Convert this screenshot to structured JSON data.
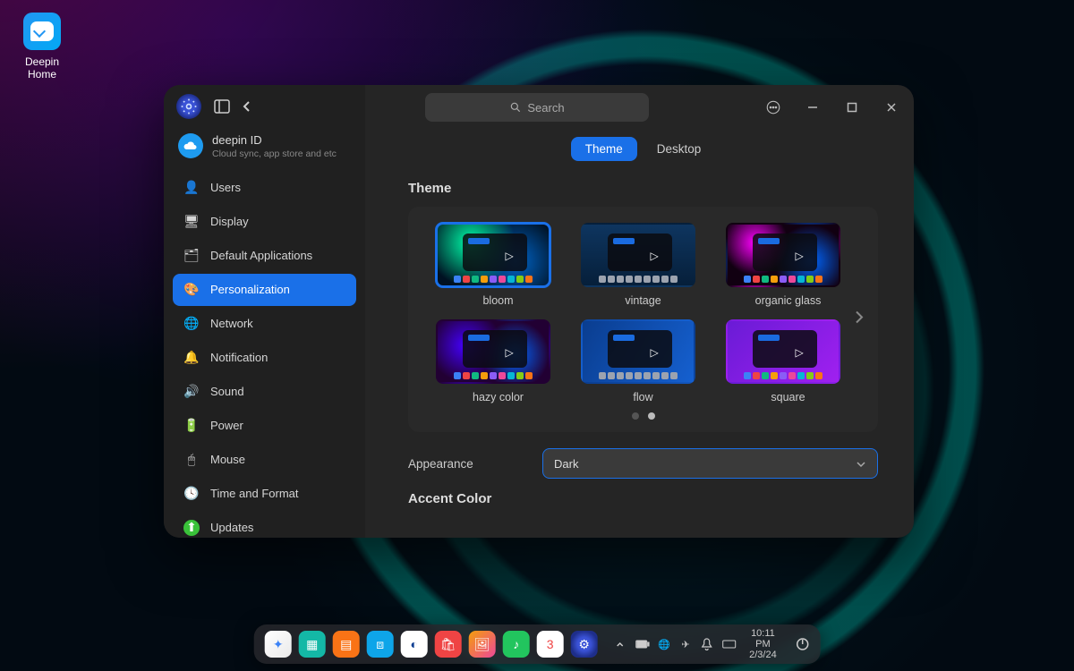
{
  "desktop": {
    "icon_label": "Deepin\nHome"
  },
  "account": {
    "title": "deepin ID",
    "subtitle": "Cloud sync, app store and etc"
  },
  "sidebar": {
    "items": [
      {
        "id": "users",
        "label": "Users",
        "icon": "user-icon",
        "icon_glyph": "👤",
        "icon_bg": "transparent"
      },
      {
        "id": "display",
        "label": "Display",
        "icon": "display-icon",
        "icon_glyph": "🖥",
        "icon_bg": "transparent"
      },
      {
        "id": "default-apps",
        "label": "Default Applications",
        "icon": "apps-icon",
        "icon_glyph": "🗂",
        "icon_bg": "transparent"
      },
      {
        "id": "personalization",
        "label": "Personalization",
        "icon": "brush-icon",
        "icon_glyph": "🎨",
        "icon_bg": "transparent"
      },
      {
        "id": "network",
        "label": "Network",
        "icon": "globe-icon",
        "icon_glyph": "🌐",
        "icon_bg": "transparent"
      },
      {
        "id": "notification",
        "label": "Notification",
        "icon": "bell-icon",
        "icon_glyph": "🔔",
        "icon_bg": "transparent"
      },
      {
        "id": "sound",
        "label": "Sound",
        "icon": "speaker-icon",
        "icon_glyph": "🔊",
        "icon_bg": "transparent"
      },
      {
        "id": "power",
        "label": "Power",
        "icon": "battery-icon",
        "icon_glyph": "🔋",
        "icon_bg": "transparent"
      },
      {
        "id": "mouse",
        "label": "Mouse",
        "icon": "mouse-icon",
        "icon_glyph": "🖱",
        "icon_bg": "transparent"
      },
      {
        "id": "time",
        "label": "Time and Format",
        "icon": "clock-icon",
        "icon_glyph": "🕓",
        "icon_bg": "transparent"
      },
      {
        "id": "updates",
        "label": "Updates",
        "icon": "update-icon",
        "icon_glyph": "⬆",
        "icon_bg": "#3ac23a"
      }
    ],
    "active_index": 3
  },
  "search": {
    "placeholder": "Search"
  },
  "tabs": {
    "items": [
      "Theme",
      "Desktop"
    ],
    "active_index": 0
  },
  "section": {
    "theme_title": "Theme",
    "accent_title": "Accent Color",
    "themes": [
      {
        "id": "bloom",
        "label": "bloom",
        "bg": "bg-bloom",
        "dock": "dock-col"
      },
      {
        "id": "vintage",
        "label": "vintage",
        "bg": "bg-vintage",
        "dock": "dock-mono"
      },
      {
        "id": "organic",
        "label": "organic glass",
        "bg": "bg-organic",
        "dock": "dock-col"
      },
      {
        "id": "hazy",
        "label": "hazy color",
        "bg": "bg-hazy",
        "dock": "dock-col"
      },
      {
        "id": "flow",
        "label": "flow",
        "bg": "bg-flow",
        "dock": "dock-mono"
      },
      {
        "id": "square",
        "label": "square",
        "bg": "bg-square",
        "dock": "dock-col"
      }
    ],
    "selected_theme_index": 0,
    "pager": {
      "count": 2,
      "active": 1
    }
  },
  "appearance": {
    "label": "Appearance",
    "value": "Dark"
  },
  "dock": {
    "apps": [
      {
        "id": "launcher",
        "name": "launcher-icon",
        "bg": "linear-gradient(135deg,#fff,#eaeaea)",
        "glyph": "✦",
        "color": "#3b82f6"
      },
      {
        "id": "multitask",
        "name": "multitask-icon",
        "bg": "#14b8a6",
        "glyph": "▦",
        "color": "#fff"
      },
      {
        "id": "files",
        "name": "files-icon",
        "bg": "#f97316",
        "glyph": "▤",
        "color": "#fff"
      },
      {
        "id": "store",
        "name": "store-icon",
        "bg": "#0ea5e9",
        "glyph": "⧈",
        "color": "#fff"
      },
      {
        "id": "browser",
        "name": "browser-icon",
        "bg": "#fff",
        "glyph": "◐",
        "color": "#0b3d91"
      },
      {
        "id": "appstore",
        "name": "bag-icon",
        "bg": "#ef4444",
        "glyph": "🛍",
        "color": "#fff"
      },
      {
        "id": "photos",
        "name": "photos-icon",
        "bg": "linear-gradient(135deg,#f59e0b,#ec4899)",
        "glyph": "🖼",
        "color": "#fff"
      },
      {
        "id": "music",
        "name": "music-icon",
        "bg": "#22c55e",
        "glyph": "♪",
        "color": "#fff"
      },
      {
        "id": "calendar",
        "name": "calendar-icon",
        "bg": "#fff",
        "glyph": "3",
        "color": "#ef4444"
      },
      {
        "id": "settings",
        "name": "settings-icon",
        "bg": "radial-gradient(circle,#3a52d6 35%,#1e2e8a 70%)",
        "glyph": "⚙",
        "color": "#fff"
      }
    ],
    "tray": {
      "time": "10:11 PM",
      "date": "2/3/24"
    }
  }
}
